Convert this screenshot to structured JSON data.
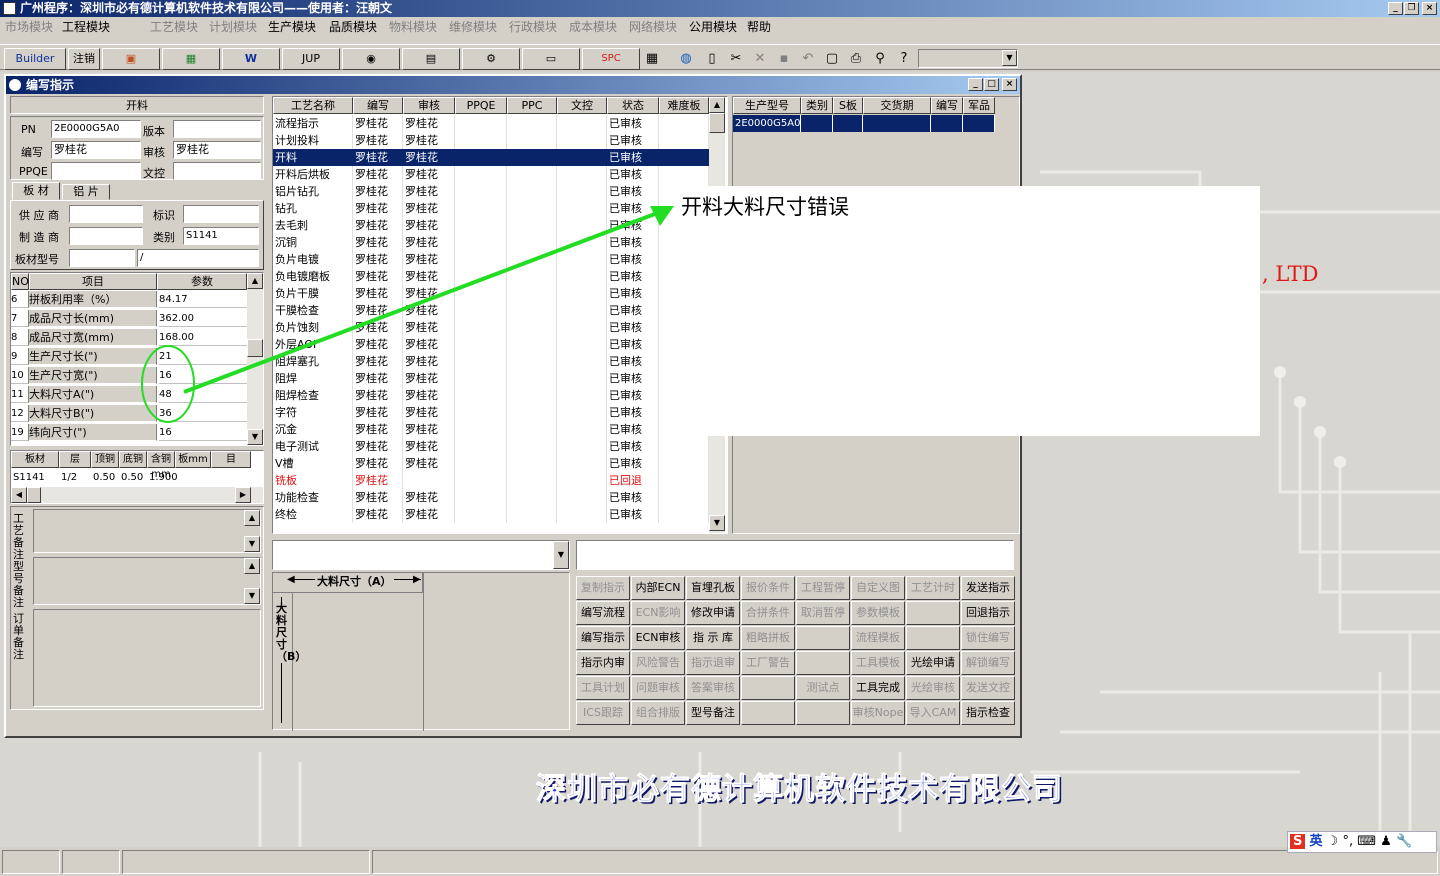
{
  "app": {
    "title": "广州程序：深圳市必有德计算机软件技术有限公司——使用者：汪朝文"
  },
  "menu": [
    {
      "label": "市场模块",
      "enabled": false
    },
    {
      "label": "工程模块",
      "enabled": true,
      "checked": true
    },
    {
      "label": "工艺模块",
      "enabled": false
    },
    {
      "label": "计划模块",
      "enabled": false
    },
    {
      "label": "生产模块",
      "enabled": true
    },
    {
      "label": "品质模块",
      "enabled": true
    },
    {
      "label": "物料模块",
      "enabled": false
    },
    {
      "label": "维修模块",
      "enabled": false
    },
    {
      "label": "行政模块",
      "enabled": false
    },
    {
      "label": "成本模块",
      "enabled": false
    },
    {
      "label": "网络模块",
      "enabled": false
    },
    {
      "label": "公用模块",
      "enabled": true
    },
    {
      "label": "帮助",
      "enabled": true
    }
  ],
  "toolbar": {
    "builder": "Builder",
    "logout": "注销",
    "jup": "JUP",
    "spc": "SPC"
  },
  "window": {
    "title": "编写指示"
  },
  "left": {
    "section_title": "开料",
    "pn_label": "PN",
    "pn_value": "2E0000G5A0",
    "version_label": "版本",
    "version_value": "",
    "writer_label": "编写",
    "writer_value": "罗桂花",
    "reviewer_label": "审核",
    "reviewer_value": "罗桂花",
    "ppqe_label": "PPQE",
    "ppqe_value": "",
    "doc_label": "文控",
    "doc_value": "",
    "tabs": [
      "板 材",
      "铝 片"
    ],
    "supplier_label": "供 应 商",
    "supplier_value": "",
    "mark_label": "标识",
    "mark_value": "",
    "maker_label": "制 造 商",
    "maker_value": "",
    "category_label": "类别",
    "category_value": "S1141",
    "model_label": "板材型号",
    "model_value": "",
    "model_value2": "/",
    "param_headers": [
      "NO",
      "项目",
      "参数"
    ],
    "params": [
      [
        "6",
        "拼板利用率（%）",
        "84.17"
      ],
      [
        "7",
        "成品尺寸长(mm)",
        "362.00"
      ],
      [
        "8",
        "成品尺寸宽(mm)",
        "168.00"
      ],
      [
        "9",
        "生产尺寸长(\")",
        "21"
      ],
      [
        "10",
        "生产尺寸宽(\")",
        "16"
      ],
      [
        "11",
        "大料尺寸A(\")",
        "48"
      ],
      [
        "12",
        "大料尺寸B(\")",
        "36"
      ],
      [
        "19",
        "纬向尺寸(\")",
        "16"
      ]
    ],
    "mat_headers": [
      "板材",
      "层",
      "顶铜",
      "底铜",
      "含铜mm",
      "板mm",
      "目"
    ],
    "mat_row": [
      "S1141",
      "1/2",
      "0.50",
      "0.50",
      "1.900",
      ""
    ],
    "notes": [
      "工艺备注",
      "型号备注",
      "订单备注"
    ]
  },
  "process": {
    "headers": [
      "工艺名称",
      "编写",
      "审核",
      "PPQE",
      "PPC",
      "文控",
      "状态",
      "难度板"
    ],
    "rows": [
      [
        "流程指示",
        "罗桂花",
        "罗桂花",
        "",
        "",
        "",
        "已审核",
        ""
      ],
      [
        "计划投料",
        "罗桂花",
        "罗桂花",
        "",
        "",
        "",
        "已审核",
        ""
      ],
      [
        "开料",
        "罗桂花",
        "罗桂花",
        "",
        "",
        "",
        "已审核",
        ""
      ],
      [
        "开料后烘板",
        "罗桂花",
        "罗桂花",
        "",
        "",
        "",
        "已审核",
        ""
      ],
      [
        "铝片钻孔",
        "罗桂花",
        "罗桂花",
        "",
        "",
        "",
        "已审核",
        ""
      ],
      [
        "钻孔",
        "罗桂花",
        "罗桂花",
        "",
        "",
        "",
        "已审核",
        ""
      ],
      [
        "去毛刺",
        "罗桂花",
        "罗桂花",
        "",
        "",
        "",
        "已审核",
        ""
      ],
      [
        "沉铜",
        "罗桂花",
        "罗桂花",
        "",
        "",
        "",
        "已审核",
        ""
      ],
      [
        "负片电镀",
        "罗桂花",
        "罗桂花",
        "",
        "",
        "",
        "已审核",
        ""
      ],
      [
        "负电镀磨板",
        "罗桂花",
        "罗桂花",
        "",
        "",
        "",
        "已审核",
        ""
      ],
      [
        "负片干膜",
        "罗桂花",
        "罗桂花",
        "",
        "",
        "",
        "已审核",
        ""
      ],
      [
        "干膜检查",
        "罗桂花",
        "罗桂花",
        "",
        "",
        "",
        "已审核",
        ""
      ],
      [
        "负片蚀刻",
        "罗桂花",
        "罗桂花",
        "",
        "",
        "",
        "已审核",
        ""
      ],
      [
        "外层AOI",
        "罗桂花",
        "罗桂花",
        "",
        "",
        "",
        "已审核",
        ""
      ],
      [
        "阻焊塞孔",
        "罗桂花",
        "罗桂花",
        "",
        "",
        "",
        "已审核",
        ""
      ],
      [
        "阻焊",
        "罗桂花",
        "罗桂花",
        "",
        "",
        "",
        "已审核",
        ""
      ],
      [
        "阻焊检查",
        "罗桂花",
        "罗桂花",
        "",
        "",
        "",
        "已审核",
        ""
      ],
      [
        "字符",
        "罗桂花",
        "罗桂花",
        "",
        "",
        "",
        "已审核",
        ""
      ],
      [
        "沉金",
        "罗桂花",
        "罗桂花",
        "",
        "",
        "",
        "已审核",
        ""
      ],
      [
        "电子测试",
        "罗桂花",
        "罗桂花",
        "",
        "",
        "",
        "已审核",
        ""
      ],
      [
        "V槽",
        "罗桂花",
        "罗桂花",
        "",
        "",
        "",
        "已审核",
        ""
      ],
      [
        "铣板",
        "罗桂花",
        "",
        "",
        "",
        "",
        "已回退",
        ""
      ],
      [
        "功能检查",
        "罗桂花",
        "罗桂花",
        "",
        "",
        "",
        "已审核",
        ""
      ],
      [
        "终检",
        "罗桂花",
        "罗桂花",
        "",
        "",
        "",
        "已审核",
        ""
      ]
    ],
    "selected_index": 2,
    "returned_index": 21
  },
  "models": {
    "headers": [
      "生产型号",
      "类别",
      "S板",
      "交货期",
      "编写",
      "军品"
    ],
    "rows": [
      [
        "2E0000G5A0",
        "",
        "",
        "",
        "",
        ""
      ]
    ]
  },
  "diagram": {
    "label_a": "大料尺寸（A）",
    "label_b": "大料尺寸（B）"
  },
  "buttons": [
    [
      {
        "l": "复制指示",
        "e": false
      },
      {
        "l": "内部ECN",
        "e": true
      },
      {
        "l": "盲埋孔板",
        "e": true
      },
      {
        "l": "报价条件",
        "e": false
      },
      {
        "l": "工程暂停",
        "e": false
      },
      {
        "l": "自定义图",
        "e": false
      },
      {
        "l": "工艺计时",
        "e": false
      },
      {
        "l": "发送指示",
        "e": true
      }
    ],
    [
      {
        "l": "编写流程",
        "e": true
      },
      {
        "l": "ECN影响",
        "e": false
      },
      {
        "l": "修改申请",
        "e": true
      },
      {
        "l": "合拼条件",
        "e": false
      },
      {
        "l": "取消暂停",
        "e": false
      },
      {
        "l": "参数模板",
        "e": false
      },
      {
        "l": "",
        "e": false
      },
      {
        "l": "回退指示",
        "e": true
      }
    ],
    [
      {
        "l": "编写指示",
        "e": true
      },
      {
        "l": "ECN审核",
        "e": true
      },
      {
        "l": "指 示 库",
        "e": true
      },
      {
        "l": "粗略拼板",
        "e": false
      },
      {
        "l": "",
        "e": false
      },
      {
        "l": "流程模板",
        "e": false
      },
      {
        "l": "",
        "e": false
      },
      {
        "l": "锁住编写",
        "e": false
      }
    ],
    [
      {
        "l": "指示内审",
        "e": true
      },
      {
        "l": "风险警告",
        "e": false
      },
      {
        "l": "指示退审",
        "e": false
      },
      {
        "l": "工厂警告",
        "e": false
      },
      {
        "l": "",
        "e": false
      },
      {
        "l": "工具模板",
        "e": false
      },
      {
        "l": "光绘申请",
        "e": true
      },
      {
        "l": "解锁编写",
        "e": false
      }
    ],
    [
      {
        "l": "工具计划",
        "e": false
      },
      {
        "l": "问题审核",
        "e": false
      },
      {
        "l": "答案审核",
        "e": false
      },
      {
        "l": "",
        "e": false
      },
      {
        "l": "测试点",
        "e": false
      },
      {
        "l": "工具完成",
        "e": true
      },
      {
        "l": "光绘审核",
        "e": false
      },
      {
        "l": "发送文控",
        "e": false
      }
    ],
    [
      {
        "l": "ICS跟踪",
        "e": false
      },
      {
        "l": "组合排版",
        "e": false
      },
      {
        "l": "型号备注",
        "e": true
      },
      {
        "l": "",
        "e": false
      },
      {
        "l": "",
        "e": false
      },
      {
        "l": "审核Nope",
        "e": false
      },
      {
        "l": "导入CAM",
        "e": false
      },
      {
        "l": "指示检查",
        "e": true
      }
    ]
  ],
  "annotation": {
    "text": "开料大料尺寸错误",
    "color": "#22dd22"
  },
  "desktop": {
    "ltd": ", LTD",
    "company": "深圳市必有德计算机软件技术有限公司"
  },
  "ime": {
    "label": "英"
  }
}
